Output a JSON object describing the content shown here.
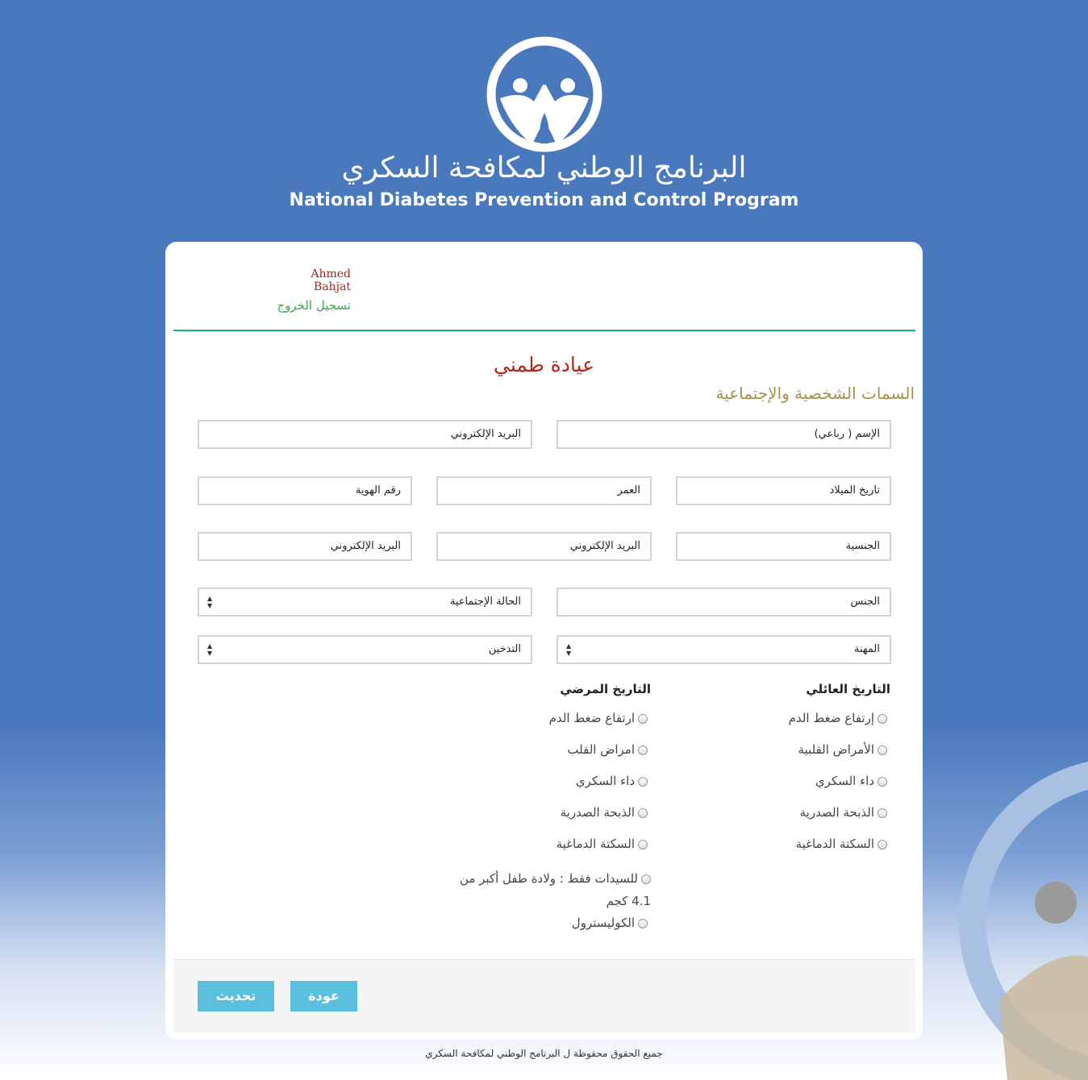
{
  "header": {
    "logo_arabic": "البرنامج الوطني لمكافحة السكري",
    "logo_english": "National Diabetes Prevention and Control Program"
  },
  "user": {
    "name": "Ahmed Bahjat",
    "logout_label": "تسجيل الخروج"
  },
  "page": {
    "title": "عيادة طمني",
    "section_title": "السمات الشخصية والإجتماعية"
  },
  "form": {
    "name_field": "الإسم ( رباعي)",
    "email_field": "البريد الإلكتروني",
    "birthdate_field": "تاريخ الميلاد",
    "age_field": "العمر",
    "id_number_field": "رقم الهوية",
    "nationality_field": "الجنسية",
    "email_field_2": "البريد الإلكتروني",
    "email_field_3": "البريد الإلكتروني",
    "gender_field": "الجنس",
    "marital_status_select": "الحالة الإجتماعية",
    "occupation_select": "المهنة",
    "smoking_select": "التدخين"
  },
  "family_history": {
    "title": "التاريخ العائلي",
    "items": [
      "إرتفاع ضغط الدم",
      "الأمراض القلبية",
      "داء السكري",
      "الذبحة الصدرية",
      "السكتة الدماغية"
    ]
  },
  "medical_history": {
    "title": "التاريخ المرضي",
    "items": [
      "ارتفاع ضغط الدم",
      "امراض القلب",
      "داء السكري",
      "الذبحة الصدرية",
      "السكتة الدماغية",
      "للسيدات فقط : ولادة طفل أكبر من 4.1 كجم",
      "الكوليسترول"
    ]
  },
  "actions": {
    "update_label": "تحديث",
    "back_label": "عودة"
  },
  "footer": {
    "copyright": "جميع الحقوق محفوظة ل البرنامج الوطني لمكافحة السكري"
  },
  "colors": {
    "background_blue": "#4a78bd",
    "title_red": "#b4261a",
    "section_gold": "#a6904e",
    "divider_green": "#22a98a",
    "button_blue": "#5bc0de"
  }
}
